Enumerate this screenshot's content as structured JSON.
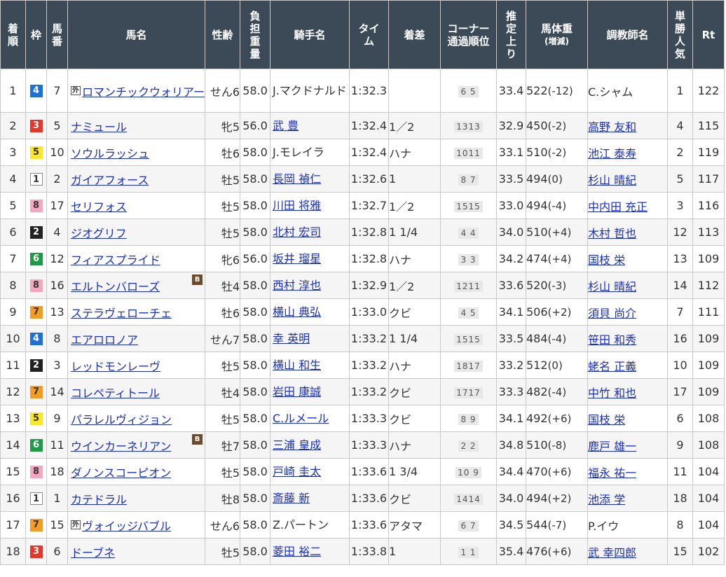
{
  "headers": {
    "rank": "着順",
    "waku": "枠",
    "umaban": "馬番",
    "horse": "馬名",
    "sex_age": "性齢",
    "weight": "負担重量",
    "jockey": "騎手名",
    "time": "タイム",
    "margin": "着差",
    "corner": "コーナー通過順位",
    "last3f": "推定上り",
    "body_weight": "馬体重",
    "body_weight_sub": "(増減)",
    "trainer": "調教師名",
    "popularity": "単勝人気",
    "rating": "Rt"
  },
  "rows": [
    {
      "rank": "1",
      "waku": "4",
      "umaban": "7",
      "foreign": "外",
      "horse": "ロマンチックウォリアー",
      "blinker": "",
      "sex_age": "せん6",
      "weight": "58.0",
      "jockey": "J.マクドナルド",
      "jockey_link": false,
      "time": "1:32.3",
      "margin": "",
      "corner": "6 5",
      "last3f": "33.4",
      "body_weight": "522",
      "diff": "(-12)",
      "trainer": "C.シャム",
      "trainer_link": false,
      "pop": "1",
      "rt": "122"
    },
    {
      "rank": "2",
      "waku": "3",
      "umaban": "5",
      "foreign": "",
      "horse": "ナミュール",
      "blinker": "",
      "sex_age": "牝5",
      "weight": "56.0",
      "jockey": "武 豊",
      "jockey_link": true,
      "time": "1:32.4",
      "margin": "1／2",
      "corner": "1313",
      "last3f": "32.9",
      "body_weight": "450",
      "diff": "(-2)",
      "trainer": "高野 友和",
      "trainer_link": true,
      "pop": "4",
      "rt": "115"
    },
    {
      "rank": "3",
      "waku": "5",
      "umaban": "10",
      "foreign": "",
      "horse": "ソウルラッシュ",
      "blinker": "",
      "sex_age": "牡6",
      "weight": "58.0",
      "jockey": "J.モレイラ",
      "jockey_link": false,
      "time": "1:32.4",
      "margin": "ハナ",
      "corner": "1011",
      "last3f": "33.1",
      "body_weight": "510",
      "diff": "(-2)",
      "trainer": "池江 泰寿",
      "trainer_link": true,
      "pop": "2",
      "rt": "119"
    },
    {
      "rank": "4",
      "waku": "1",
      "umaban": "2",
      "foreign": "",
      "horse": "ガイアフォース",
      "blinker": "",
      "sex_age": "牡5",
      "weight": "58.0",
      "jockey": "長岡 禎仁",
      "jockey_link": true,
      "time": "1:32.6",
      "margin": "1",
      "corner": "8 7",
      "last3f": "33.5",
      "body_weight": "494",
      "diff": "(0)",
      "trainer": "杉山 晴紀",
      "trainer_link": true,
      "pop": "5",
      "rt": "117"
    },
    {
      "rank": "5",
      "waku": "8",
      "umaban": "17",
      "foreign": "",
      "horse": "セリフォス",
      "blinker": "",
      "sex_age": "牡5",
      "weight": "58.0",
      "jockey": "川田 将雅",
      "jockey_link": true,
      "time": "1:32.7",
      "margin": "1／2",
      "corner": "1515",
      "last3f": "33.0",
      "body_weight": "494",
      "diff": "(-4)",
      "trainer": "中内田 充正",
      "trainer_link": true,
      "pop": "3",
      "rt": "116"
    },
    {
      "rank": "6",
      "waku": "2",
      "umaban": "4",
      "foreign": "",
      "horse": "ジオグリフ",
      "blinker": "",
      "sex_age": "牡5",
      "weight": "58.0",
      "jockey": "北村 宏司",
      "jockey_link": true,
      "time": "1:32.8",
      "margin": "1 1/4",
      "corner": "4 4",
      "last3f": "34.0",
      "body_weight": "510",
      "diff": "(+4)",
      "trainer": "木村 哲也",
      "trainer_link": true,
      "pop": "12",
      "rt": "113"
    },
    {
      "rank": "7",
      "waku": "6",
      "umaban": "12",
      "foreign": "",
      "horse": "フィアスプライド",
      "blinker": "",
      "sex_age": "牝6",
      "weight": "56.0",
      "jockey": "坂井 瑠星",
      "jockey_link": true,
      "time": "1:32.8",
      "margin": "ハナ",
      "corner": "3 3",
      "last3f": "34.2",
      "body_weight": "474",
      "diff": "(+4)",
      "trainer": "国枝 栄",
      "trainer_link": true,
      "pop": "13",
      "rt": "109"
    },
    {
      "rank": "8",
      "waku": "8",
      "umaban": "16",
      "foreign": "",
      "horse": "エルトンバローズ",
      "blinker": "B",
      "sex_age": "牡4",
      "weight": "58.0",
      "jockey": "西村 淳也",
      "jockey_link": true,
      "time": "1:32.9",
      "margin": "1／2",
      "corner": "1211",
      "last3f": "33.6",
      "body_weight": "520",
      "diff": "(-3)",
      "trainer": "杉山 晴紀",
      "trainer_link": true,
      "pop": "14",
      "rt": "112"
    },
    {
      "rank": "9",
      "waku": "7",
      "umaban": "13",
      "foreign": "",
      "horse": "ステラヴェローチェ",
      "blinker": "",
      "sex_age": "牡6",
      "weight": "58.0",
      "jockey": "横山 典弘",
      "jockey_link": true,
      "time": "1:33.0",
      "margin": "クビ",
      "corner": "4 5",
      "last3f": "34.1",
      "body_weight": "506",
      "diff": "(+2)",
      "trainer": "須貝 尚介",
      "trainer_link": true,
      "pop": "7",
      "rt": "111"
    },
    {
      "rank": "10",
      "waku": "4",
      "umaban": "8",
      "foreign": "",
      "horse": "エアロロノア",
      "blinker": "",
      "sex_age": "せん7",
      "weight": "58.0",
      "jockey": "幸 英明",
      "jockey_link": true,
      "time": "1:33.2",
      "margin": "1 1/4",
      "corner": "1515",
      "last3f": "33.5",
      "body_weight": "484",
      "diff": "(-4)",
      "trainer": "笹田 和秀",
      "trainer_link": true,
      "pop": "16",
      "rt": "109"
    },
    {
      "rank": "11",
      "waku": "2",
      "umaban": "3",
      "foreign": "",
      "horse": "レッドモンレーヴ",
      "blinker": "",
      "sex_age": "牡5",
      "weight": "58.0",
      "jockey": "横山 和生",
      "jockey_link": true,
      "time": "1:33.2",
      "margin": "ハナ",
      "corner": "1817",
      "last3f": "33.2",
      "body_weight": "512",
      "diff": "(0)",
      "trainer": "蛯名 正義",
      "trainer_link": true,
      "pop": "10",
      "rt": "109"
    },
    {
      "rank": "12",
      "waku": "7",
      "umaban": "14",
      "foreign": "",
      "horse": "コレペティトール",
      "blinker": "",
      "sex_age": "牡4",
      "weight": "58.0",
      "jockey": "岩田 康誠",
      "jockey_link": true,
      "time": "1:33.2",
      "margin": "クビ",
      "corner": "1717",
      "last3f": "33.3",
      "body_weight": "482",
      "diff": "(-4)",
      "trainer": "中竹 和也",
      "trainer_link": true,
      "pop": "17",
      "rt": "109"
    },
    {
      "rank": "13",
      "waku": "5",
      "umaban": "9",
      "foreign": "",
      "horse": "パラレルヴィジョン",
      "blinker": "",
      "sex_age": "牡5",
      "weight": "58.0",
      "jockey": "C.ルメール",
      "jockey_link": true,
      "time": "1:33.3",
      "margin": "クビ",
      "corner": "8 9",
      "last3f": "34.1",
      "body_weight": "492",
      "diff": "(+6)",
      "trainer": "国枝 栄",
      "trainer_link": true,
      "pop": "6",
      "rt": "108"
    },
    {
      "rank": "14",
      "waku": "6",
      "umaban": "11",
      "foreign": "",
      "horse": "ウインカーネリアン",
      "blinker": "B",
      "sex_age": "牡7",
      "weight": "58.0",
      "jockey": "三浦 皇成",
      "jockey_link": true,
      "time": "1:33.3",
      "margin": "ハナ",
      "corner": "2 2",
      "last3f": "34.8",
      "body_weight": "510",
      "diff": "(-8)",
      "trainer": "鹿戸 雄一",
      "trainer_link": true,
      "pop": "9",
      "rt": "108"
    },
    {
      "rank": "15",
      "waku": "8",
      "umaban": "18",
      "foreign": "",
      "horse": "ダノンスコーピオン",
      "blinker": "",
      "sex_age": "牡5",
      "weight": "58.0",
      "jockey": "戸崎 圭太",
      "jockey_link": true,
      "time": "1:33.6",
      "margin": "1 3/4",
      "corner": "10 9",
      "last3f": "34.4",
      "body_weight": "470",
      "diff": "(+6)",
      "trainer": "福永 祐一",
      "trainer_link": true,
      "pop": "11",
      "rt": "104"
    },
    {
      "rank": "16",
      "waku": "1",
      "umaban": "1",
      "foreign": "",
      "horse": "カテドラル",
      "blinker": "",
      "sex_age": "牡8",
      "weight": "58.0",
      "jockey": "斎藤 新",
      "jockey_link": true,
      "time": "1:33.6",
      "margin": "クビ",
      "corner": "1414",
      "last3f": "34.0",
      "body_weight": "494",
      "diff": "(+2)",
      "trainer": "池添 学",
      "trainer_link": true,
      "pop": "18",
      "rt": "104"
    },
    {
      "rank": "17",
      "waku": "7",
      "umaban": "15",
      "foreign": "外",
      "horse": "ヴォイッジバブル",
      "blinker": "",
      "sex_age": "せん6",
      "weight": "58.0",
      "jockey": "Z.パートン",
      "jockey_link": false,
      "time": "1:33.6",
      "margin": "アタマ",
      "corner": "6 7",
      "last3f": "34.5",
      "body_weight": "544",
      "diff": "(-7)",
      "trainer": "P.イウ",
      "trainer_link": false,
      "pop": "8",
      "rt": "104"
    },
    {
      "rank": "18",
      "waku": "3",
      "umaban": "6",
      "foreign": "",
      "horse": "ドーブネ",
      "blinker": "",
      "sex_age": "牡5",
      "weight": "58.0",
      "jockey": "菱田 裕二",
      "jockey_link": true,
      "time": "1:33.8",
      "margin": "1",
      "corner": "1 1",
      "last3f": "35.4",
      "body_weight": "476",
      "diff": "(+6)",
      "trainer": "武 幸四郎",
      "trainer_link": true,
      "pop": "15",
      "rt": "102"
    }
  ]
}
